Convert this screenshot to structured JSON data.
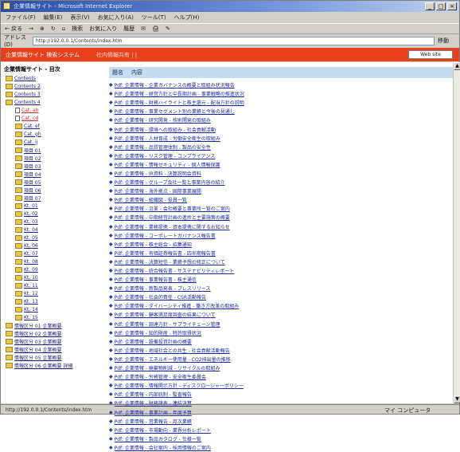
{
  "window": {
    "title": "企業情報サイト - Microsoft Internet Explorer",
    "controls": [
      "_",
      "□",
      "×"
    ]
  },
  "menubar": [
    "ファイル(F)",
    "編集(E)",
    "表示(V)",
    "お気に入り(A)",
    "ツール(T)",
    "ヘルプ(H)"
  ],
  "toolbar": [
    "← 戻る",
    "→",
    "⊗",
    "↻",
    "⌂",
    "検索",
    "お気に入り",
    "履歴",
    "✉",
    "🖨",
    "✎"
  ],
  "addressbar": {
    "label": "アドレス(D)",
    "value": "http://192.0.0.1/Contents/index.htm",
    "go": "移動"
  },
  "banner": {
    "site": "企業情報サイト 検索システム",
    "subtitle": "社内情報共有 |  |  ",
    "button": "Web site"
  },
  "sidebar": {
    "root": "企業情報サイト - 目次",
    "items": [
      {
        "label": "Contents",
        "kind": "folder",
        "red": false
      },
      {
        "label": "Contents 2",
        "kind": "folder",
        "red": false
      },
      {
        "label": "Contents 3",
        "kind": "folder",
        "red": false
      },
      {
        "label": "Contents 4",
        "kind": "folder",
        "red": false
      },
      {
        "label": "Cat. ab",
        "kind": "doc",
        "red": true
      },
      {
        "label": "Cat. cd",
        "kind": "doc",
        "red": true
      },
      {
        "label": "Cat. ef",
        "kind": "folder",
        "red": false
      },
      {
        "label": "Cat. gh",
        "kind": "folder",
        "red": false
      },
      {
        "label": "Cat. ij",
        "kind": "folder",
        "red": false
      },
      {
        "label": "項目 01",
        "kind": "folder",
        "red": false
      },
      {
        "label": "項目 02",
        "kind": "folder",
        "red": false
      },
      {
        "label": "項目 03",
        "kind": "folder",
        "red": false
      },
      {
        "label": "項目 04",
        "kind": "folder",
        "red": false
      },
      {
        "label": "項目 05",
        "kind": "folder",
        "red": false
      },
      {
        "label": "項目 06",
        "kind": "folder",
        "red": false
      },
      {
        "label": "項目 07",
        "kind": "folder",
        "red": false
      },
      {
        "label": "Kt. 01",
        "kind": "folder",
        "red": false
      },
      {
        "label": "Kt. 02",
        "kind": "folder",
        "red": false
      },
      {
        "label": "Kt. 03",
        "kind": "folder",
        "red": false
      },
      {
        "label": "Kt. 04",
        "kind": "folder",
        "red": false
      },
      {
        "label": "Kt. 05",
        "kind": "folder",
        "red": false
      },
      {
        "label": "Kt. 06",
        "kind": "folder",
        "red": false
      },
      {
        "label": "Kt. 07",
        "kind": "folder",
        "red": false
      },
      {
        "label": "Kt. 08",
        "kind": "folder",
        "red": false
      },
      {
        "label": "Kt. 09",
        "kind": "folder",
        "red": false
      },
      {
        "label": "Kt. 10",
        "kind": "folder",
        "red": false
      },
      {
        "label": "Kt. 11",
        "kind": "folder",
        "red": false
      },
      {
        "label": "Kt. 12",
        "kind": "folder",
        "red": false
      },
      {
        "label": "Kt. 13",
        "kind": "folder",
        "red": false
      },
      {
        "label": "Kt. 14",
        "kind": "folder",
        "red": false
      },
      {
        "label": "Kt. 15",
        "kind": "folder",
        "red": false
      },
      {
        "label": "情報区分 01 企業概要",
        "kind": "folder",
        "red": false
      },
      {
        "label": "情報区分 02 企業概要",
        "kind": "folder",
        "red": false
      },
      {
        "label": "情報区分 03 企業概要",
        "kind": "folder",
        "red": false
      },
      {
        "label": "情報区分 04 企業概要",
        "kind": "folder",
        "red": false
      },
      {
        "label": "情報区分 05 企業概要",
        "kind": "folder",
        "red": false
      },
      {
        "label": "情報区分 06 企業概要 詳細",
        "kind": "folder",
        "red": false
      }
    ]
  },
  "main": {
    "headers": [
      "題名",
      "内容"
    ],
    "links": [
      "Pdf: 企業情報 - 企業ガバナンスの概要と取組み状況報告",
      "Pdf: 企業情報 - 経営方針と中長期計画 - 事業戦略の推進状況",
      "Pdf: 企業情報 - 財務ハイライトと株主還元 - 配当方針の説明",
      "Pdf: 企業情報 - 事業セグメント別の業績と今後の見通し",
      "Pdf: 企業情報 - 研究開発 - 技術開発の取組み",
      "Pdf: 企業情報 - 環境への取組み - 社会貢献活動",
      "Pdf: 企業情報 - 人材育成 - 労働安全衛生の取組み",
      "Pdf: 企業情報 - 品質管理体制 - 製品の安全性",
      "Pdf: 企業情報 - リスク管理 - コンプライアンス",
      "Pdf: 企業情報 - 情報セキュリティ - 個人情報保護",
      "Pdf: 企業情報 - IR資料 - 決算説明会資料",
      "Pdf: 企業情報 - グループ会社一覧と事業内容の紹介",
      "Pdf: 企業情報 - 海外拠点 - 国際事業展開",
      "Pdf: 企業情報 - 組織図 - 役員一覧",
      "Pdf: 企業情報 - 沿革 - 会社概要と事業所一覧のご案内",
      "Pdf: 企業情報 - 中期経営計画の進捗と主要施策の概要",
      "Pdf: 企業情報 - 業務提携 - 資本提携に関するお知らせ",
      "Pdf: 企業情報 - コーポレートガバナンス報告書",
      "Pdf: 企業情報 - 株主総会 - 招集通知",
      "Pdf: 企業情報 - 有価証券報告書 - 四半期報告書",
      "Pdf: 企業情報 - 決算短信 - 業績予想の修正について",
      "Pdf: 企業情報 - 統合報告書 - サステナビリティレポート",
      "Pdf: 企業情報 - 事業報告書 - 株主通信",
      "Pdf: 企業情報 - 新製品発表 - プレスリリース",
      "Pdf: 企業情報 - 社会的責任 - CSR活動報告",
      "Pdf: 企業情報 - ダイバーシティ推進 - 働き方改革の取組み",
      "Pdf: 企業情報 - 顧客満足度調査の結果について",
      "Pdf: 企業情報 - 調達方針 - サプライチェーン管理",
      "Pdf: 企業情報 - 知的財産 - 特許取得状況",
      "Pdf: 企業情報 - 設備投資計画の概要",
      "Pdf: 企業情報 - 地域社会との共生 - 社会貢献活動報告",
      "Pdf: 企業情報 - エネルギー使用量 - CO2排出量の推移",
      "Pdf: 企業情報 - 廃棄物削減 - リサイクルの取組み",
      "Pdf: 企業情報 - 労務管理 - 安全衛生委員会",
      "Pdf: 企業情報 - 情報開示方針 - ディスクロージャーポリシー",
      "Pdf: 企業情報 - 内部統制 - 監査報告",
      "Pdf: 企業情報 - 財務諸表 - 連結決算",
      "Pdf: 企業情報 - 事業計画 - 年度予算",
      "Pdf: 企業情報 - 営業報告 - 月次業績",
      "Pdf: 企業情報 - 市場動向 - 業界分析レポート",
      "Pdf: 企業情報 - 製品カタログ - 仕様一覧",
      "Pdf: 企業情報 - 会社案内 - 採用情報のご案内"
    ]
  },
  "statusbar": {
    "text": "http://192.0.0.1/Contents/index.htm",
    "zone": "マイ コンピュータ"
  }
}
